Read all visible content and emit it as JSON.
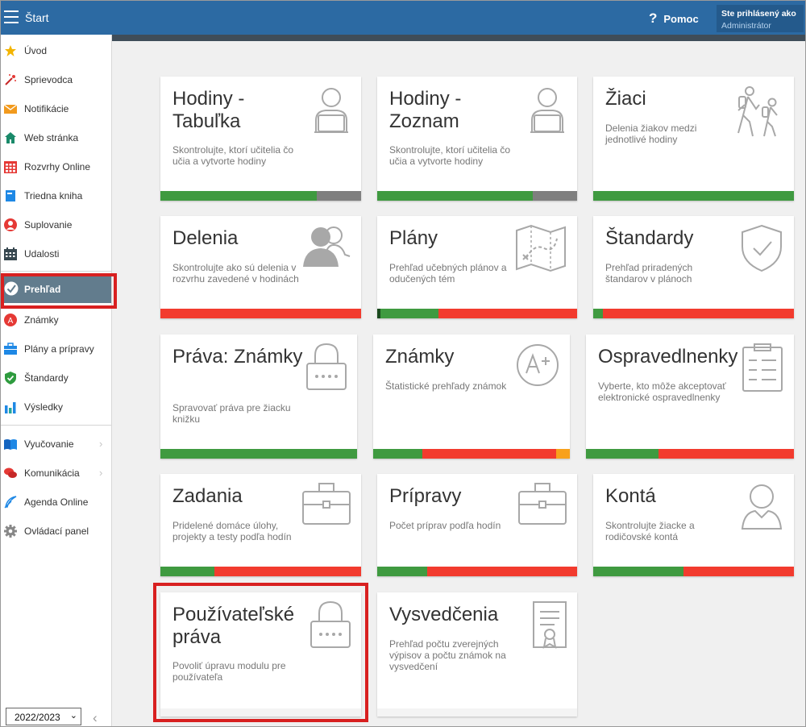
{
  "topbar": {
    "title": "Štart",
    "help": "Pomoc",
    "user_line1": "Ste prihlásený ako",
    "user_line2": "Administrátor",
    "menu_icon": "hamburger-icon",
    "help_icon": "question-icon"
  },
  "sidebar": {
    "items": [
      {
        "label": "Úvod",
        "icon": "star-icon"
      },
      {
        "label": "Sprievodca",
        "icon": "magic-wand-icon"
      },
      {
        "label": "Notifikácie",
        "icon": "envelope-icon"
      },
      {
        "label": "Web stránka",
        "icon": "home-icon"
      },
      {
        "label": "Rozvrhy Online",
        "icon": "calendar-grid-icon"
      },
      {
        "label": "Triedna kniha",
        "icon": "book-icon"
      },
      {
        "label": "Suplovanie",
        "icon": "user-icon"
      },
      {
        "label": "Udalosti",
        "icon": "calendar-icon"
      }
    ],
    "active": {
      "label": "Prehľad",
      "icon": "check-badge-icon"
    },
    "items2": [
      {
        "label": "Známky",
        "icon": "grade-icon"
      },
      {
        "label": "Plány a prípravy",
        "icon": "briefcase-icon"
      },
      {
        "label": "Štandardy",
        "icon": "shield-check-icon"
      },
      {
        "label": "Výsledky",
        "icon": "bar-chart-icon"
      }
    ],
    "items3": [
      {
        "label": "Vyučovanie",
        "icon": "open-book-icon"
      },
      {
        "label": "Komunikácia",
        "icon": "chat-icon"
      },
      {
        "label": "Agenda Online",
        "icon": "feather-icon"
      },
      {
        "label": "Ovládací panel",
        "icon": "gear-icon"
      }
    ],
    "year": "2022/2023"
  },
  "tiles": [
    {
      "title": "Hodiny - Tabuľka",
      "desc": "Skontrolujte, ktorí učitelia čo učia a vytvorte hodiny",
      "icon": "teacher-laptop-icon",
      "bar": [
        [
          "g",
          0.78
        ],
        [
          "gy",
          0.22
        ]
      ]
    },
    {
      "title": "Hodiny - Zoznam",
      "desc": "Skontrolujte, ktorí učitelia čo učia a vytvorte hodiny",
      "icon": "teacher-laptop-icon",
      "bar": [
        [
          "g",
          0.78
        ],
        [
          "gy",
          0.22
        ]
      ]
    },
    {
      "title": "Žiaci",
      "desc": "Delenia žiakov medzi jednotlivé hodiny",
      "icon": "students-walking-icon",
      "bar": [
        [
          "g",
          1
        ]
      ]
    },
    {
      "title": "Delenia",
      "desc": "Skontrolujte ako sú delenia v rozvrhu zavedené v hodinách",
      "icon": "people-icon",
      "bar": [
        [
          "r",
          1
        ]
      ]
    },
    {
      "title": "Plány",
      "desc": "Prehľad učebných plánov a odučených tém",
      "icon": "map-icon",
      "bar": [
        [
          "dk",
          0.015
        ],
        [
          "g",
          0.29
        ],
        [
          "r",
          0.695
        ]
      ]
    },
    {
      "title": "Štandardy",
      "desc": "Prehľad priradených štandarov v plánoch",
      "icon": "shield-check-icon",
      "bar": [
        [
          "g",
          0.05
        ],
        [
          "r",
          0.95
        ]
      ]
    },
    {
      "title": "Práva: Známky",
      "desc": "Spravovať práva pre žiacku knižku",
      "icon": "padlock-icon",
      "bar": [
        [
          "g",
          1
        ]
      ]
    },
    {
      "title": "Známky",
      "desc": "Štatistické prehľady známok",
      "icon": "grade-a-plus-icon",
      "bar": [
        [
          "g",
          0.25
        ],
        [
          "r",
          0.68
        ],
        [
          "o",
          0.07
        ]
      ]
    },
    {
      "title": "Ospravedlnenky",
      "desc": "Vyberte, kto môže akceptovať elektronické ospravedlnenky",
      "icon": "clipboard-icon",
      "bar": [
        [
          "g",
          0.35
        ],
        [
          "r",
          0.65
        ]
      ]
    },
    {
      "title": "Zadania",
      "desc": "Pridelené domáce úlohy, projekty a testy podľa hodín",
      "icon": "briefcase-icon",
      "bar": [
        [
          "g",
          0.27
        ],
        [
          "r",
          0.73
        ]
      ]
    },
    {
      "title": "Prípravy",
      "desc": "Počet príprav podľa hodín",
      "icon": "briefcase-icon",
      "bar": [
        [
          "g",
          0.25
        ],
        [
          "r",
          0.75
        ]
      ]
    },
    {
      "title": "Kontá",
      "desc": "Skontrolujte žiacke a rodičovské kontá",
      "icon": "user-outline-icon",
      "bar": [
        [
          "g",
          0.45
        ],
        [
          "r",
          0.55
        ]
      ]
    },
    {
      "title": "Používateľské práva",
      "desc": "Povoliť úpravu modulu pre používateľa",
      "icon": "padlock-icon",
      "bar": []
    },
    {
      "title": "Vysvedčenia",
      "desc": "Prehľad počtu zverejných výpisov a počtu známok na vysvedčení",
      "icon": "certificate-icon",
      "bar": []
    }
  ]
}
